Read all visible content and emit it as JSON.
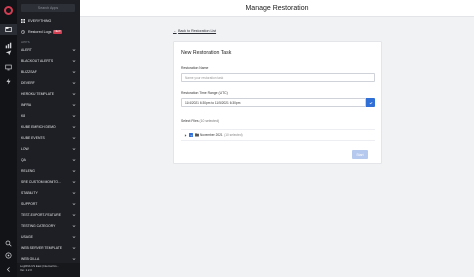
{
  "rail": {
    "icons": [
      "logo-icon",
      "folder-icon",
      "chart-icon",
      "plane-icon",
      "monitor-icon",
      "bolt-icon",
      "search-icon",
      "help-icon"
    ]
  },
  "sidebar": {
    "search_placeholder": "Search Apps",
    "top_items": [
      {
        "label": "EVERYTHING",
        "icon": "grid-icon"
      },
      {
        "label": "Restored Logs",
        "icon": "history-icon",
        "badge": "NEW"
      }
    ],
    "section_label": "APPS",
    "items": [
      "ALERT",
      "BLACKOUT ALERTS",
      "BLIZZSAF",
      "DEVERF",
      "HEROKU TEMPLATE",
      "INFRA",
      "K8",
      "KUBE EMRICH DEMO",
      "KUBE EVENTS",
      "LOW",
      "QA",
      "RELENG",
      "SRE CUSTOM MONITO...",
      "STABILITY",
      "SUPPORT",
      "TEST-EXPORT-FEATURE",
      "TESTING CATEGORY",
      "USAGE",
      "WEB SERVER TEMPLATE",
      "WEB GILLA"
    ],
    "footer": [
      "LogDNA US East (Internal Us...",
      "Ver. 1.2.0"
    ]
  },
  "header": {
    "title": "Manage Restoration"
  },
  "page": {
    "back_link": "Back to Restoration List"
  },
  "form": {
    "title": "New Restoration Task",
    "name_label": "Restoration Name",
    "name_placeholder": "Name your restoration task",
    "range_label": "Restoration Time Range (UTC)",
    "range_value": "11/4/2021 6:30pm to 11/5/2021 6:30pm",
    "files_label": "Select Files",
    "files_selected": "(10 selected)",
    "tree_item_name": "November 2021",
    "tree_item_selected": "(10 selected)",
    "start_label": "Start"
  },
  "colors": {
    "accent": "#2f6fd6",
    "brand": "#d33d52",
    "rail_bg": "#121317",
    "sidebar_bg": "#1d1f24"
  }
}
